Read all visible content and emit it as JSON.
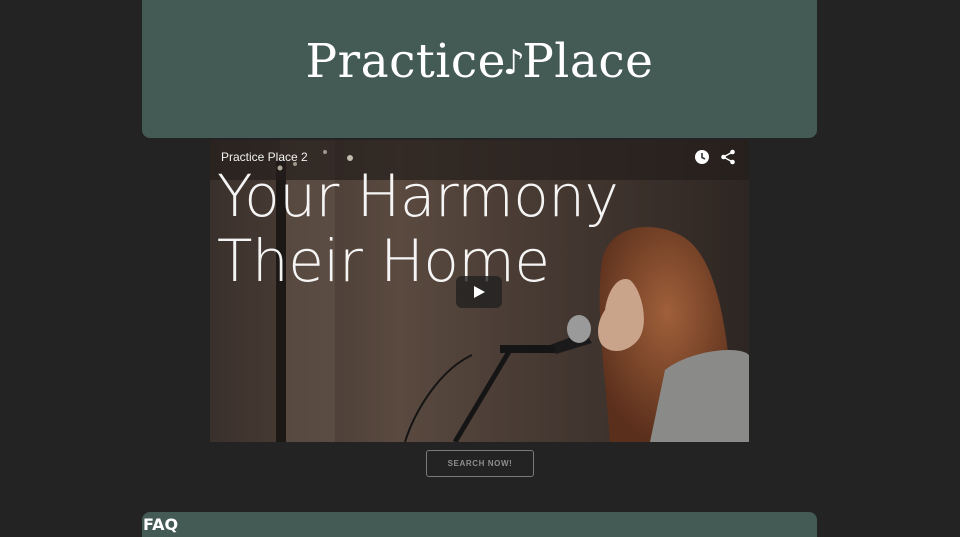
{
  "header": {
    "logo_part1": "Practice",
    "logo_note": "♪",
    "logo_part2": "Place"
  },
  "video": {
    "title": "Practice Place 2",
    "overlay_line1": "Your Harmony",
    "overlay_line2": "Their Home",
    "icons": [
      "watch-later-icon",
      "share-icon",
      "play-icon"
    ]
  },
  "cta": {
    "search_label": "SEARCH NOW!"
  },
  "faq": {
    "title": "FAQ"
  },
  "colors": {
    "page_background": "#232323",
    "panel": "#445a55",
    "text": "#ffffff",
    "button_border": "#7b7b7b"
  }
}
